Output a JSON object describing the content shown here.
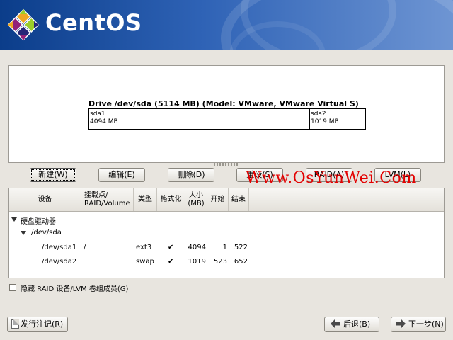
{
  "brand": {
    "name": "CentOS"
  },
  "drive": {
    "title": "Drive /dev/sda (5114 MB) (Model: VMware, VMware Virtual S)",
    "partitions": [
      {
        "name": "sda1",
        "size": "4094 MB"
      },
      {
        "name": "sda2",
        "size": "1019 MB"
      }
    ]
  },
  "toolbar": {
    "new": "新建(W)",
    "edit": "编辑(E)",
    "delete": "删除(D)",
    "reset": "重设(S)",
    "raid": "RAID(A)",
    "lvm": "LVM(L)"
  },
  "watermark": "Www.OsYunWei.Com",
  "table": {
    "headers": {
      "device": "设备",
      "mount": "挂载点/\nRAID/Volume",
      "type": "类型",
      "format": "格式化",
      "size": "大小\n(MB)",
      "start": "开始",
      "end": "结束"
    },
    "tree": {
      "root": "硬盘驱动器",
      "disk": "/dev/sda",
      "rows": [
        {
          "device": "/dev/sda1",
          "mount": "/",
          "type": "ext3",
          "format": "✔",
          "size": "4094",
          "start": "1",
          "end": "522"
        },
        {
          "device": "/dev/sda2",
          "mount": "",
          "type": "swap",
          "format": "✔",
          "size": "1019",
          "start": "523",
          "end": "652"
        }
      ]
    }
  },
  "hide_raid_checkbox": {
    "label": "隐藏 RAID 设备/LVM 卷组成员(G)",
    "checked": false
  },
  "footer": {
    "release_notes": "发行注记(R)",
    "back": "后退(B)",
    "next": "下一步(N)"
  },
  "colors": {
    "banner_dark": "#0b3d8a",
    "watermark": "#e30000"
  }
}
